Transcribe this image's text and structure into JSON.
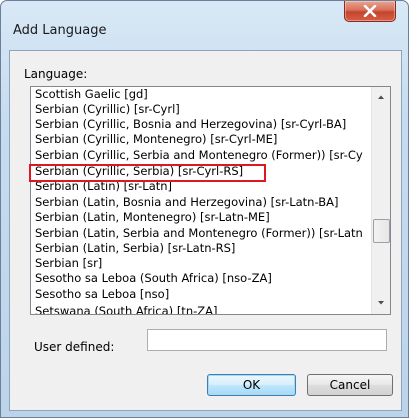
{
  "window": {
    "title": "Add Language"
  },
  "language": {
    "label": "Language:",
    "items": [
      "Scottish Gaelic [gd]",
      "Serbian (Cyrillic) [sr-Cyrl]",
      "Serbian (Cyrillic, Bosnia and Herzegovina) [sr-Cyrl-BA]",
      "Serbian (Cyrillic, Montenegro) [sr-Cyrl-ME]",
      "Serbian (Cyrillic, Serbia and Montenegro (Former)) [sr-Cy",
      "Serbian (Cyrillic, Serbia) [sr-Cyrl-RS]",
      "Serbian (Latin) [sr-Latn]",
      "Serbian (Latin, Bosnia and Herzegovina) [sr-Latn-BA]",
      "Serbian (Latin, Montenegro) [sr-Latn-ME]",
      "Serbian (Latin, Serbia and Montenegro (Former)) [sr-Latn",
      "Serbian (Latin, Serbia) [sr-Latn-RS]",
      "Serbian [sr]",
      "Sesotho sa Leboa (South Africa) [nso-ZA]",
      "Sesotho sa Leboa [nso]",
      "Setswana (South Africa) [tn-ZA]"
    ],
    "highlighted_item": "Serbian (Cyrillic, Serbia) [sr-Cyrl-RS]"
  },
  "user_defined": {
    "label": "User defined:",
    "value": ""
  },
  "buttons": {
    "ok": "OK",
    "cancel": "Cancel"
  },
  "colors": {
    "highlight_border": "#e0171f",
    "close_button": "#c4452e",
    "ok_button_border": "#3c7fb1"
  },
  "icons": {
    "close": "close-icon",
    "scroll_up": "scroll-up-arrow-icon",
    "scroll_down": "scroll-down-arrow-icon"
  }
}
